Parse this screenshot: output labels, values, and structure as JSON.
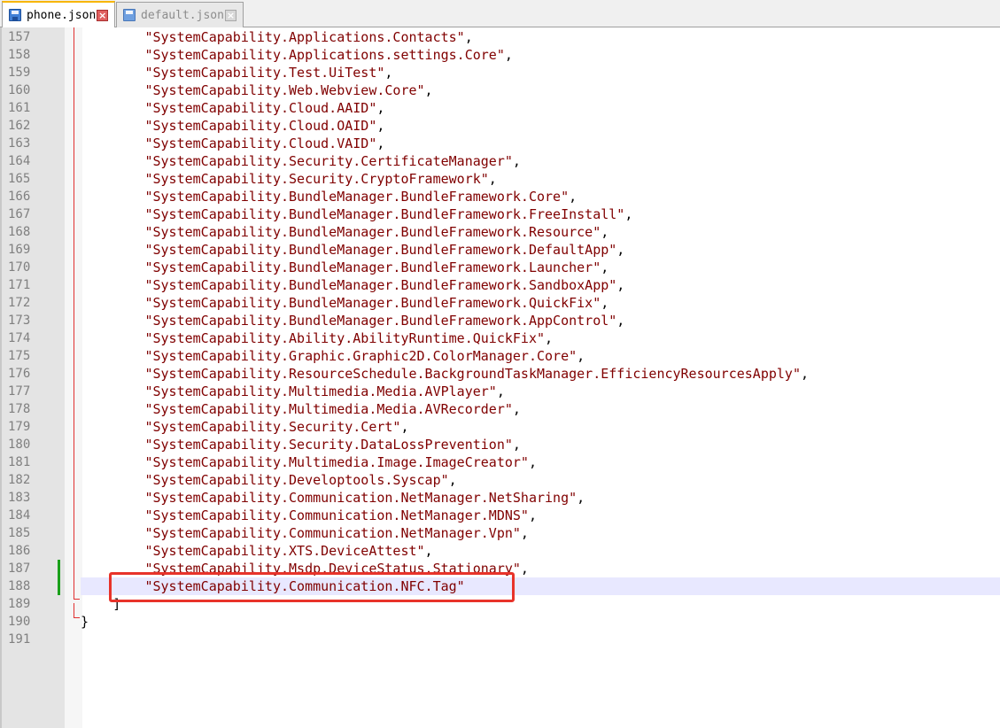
{
  "tabs": [
    {
      "label": "phone.json",
      "active": true
    },
    {
      "label": "default.json",
      "active": false
    }
  ],
  "editor": {
    "lines": [
      {
        "num": "157",
        "text": "\"SystemCapability.Applications.Contacts\",",
        "indent": 4
      },
      {
        "num": "158",
        "text": "\"SystemCapability.Applications.settings.Core\",",
        "indent": 4
      },
      {
        "num": "159",
        "text": "\"SystemCapability.Test.UiTest\",",
        "indent": 4
      },
      {
        "num": "160",
        "text": "\"SystemCapability.Web.Webview.Core\",",
        "indent": 4
      },
      {
        "num": "161",
        "text": "\"SystemCapability.Cloud.AAID\",",
        "indent": 4
      },
      {
        "num": "162",
        "text": "\"SystemCapability.Cloud.OAID\",",
        "indent": 4
      },
      {
        "num": "163",
        "text": "\"SystemCapability.Cloud.VAID\",",
        "indent": 4
      },
      {
        "num": "164",
        "text": "\"SystemCapability.Security.CertificateManager\",",
        "indent": 4
      },
      {
        "num": "165",
        "text": "\"SystemCapability.Security.CryptoFramework\",",
        "indent": 4
      },
      {
        "num": "166",
        "text": "\"SystemCapability.BundleManager.BundleFramework.Core\",",
        "indent": 4
      },
      {
        "num": "167",
        "text": "\"SystemCapability.BundleManager.BundleFramework.FreeInstall\",",
        "indent": 4
      },
      {
        "num": "168",
        "text": "\"SystemCapability.BundleManager.BundleFramework.Resource\",",
        "indent": 4
      },
      {
        "num": "169",
        "text": "\"SystemCapability.BundleManager.BundleFramework.DefaultApp\",",
        "indent": 4
      },
      {
        "num": "170",
        "text": "\"SystemCapability.BundleManager.BundleFramework.Launcher\",",
        "indent": 4
      },
      {
        "num": "171",
        "text": "\"SystemCapability.BundleManager.BundleFramework.SandboxApp\",",
        "indent": 4
      },
      {
        "num": "172",
        "text": "\"SystemCapability.BundleManager.BundleFramework.QuickFix\",",
        "indent": 4
      },
      {
        "num": "173",
        "text": "\"SystemCapability.BundleManager.BundleFramework.AppControl\",",
        "indent": 4
      },
      {
        "num": "174",
        "text": "\"SystemCapability.Ability.AbilityRuntime.QuickFix\",",
        "indent": 4
      },
      {
        "num": "175",
        "text": "\"SystemCapability.Graphic.Graphic2D.ColorManager.Core\",",
        "indent": 4
      },
      {
        "num": "176",
        "text": "\"SystemCapability.ResourceSchedule.BackgroundTaskManager.EfficiencyResourcesApply\",",
        "indent": 4
      },
      {
        "num": "177",
        "text": "\"SystemCapability.Multimedia.Media.AVPlayer\",",
        "indent": 4
      },
      {
        "num": "178",
        "text": "\"SystemCapability.Multimedia.Media.AVRecorder\",",
        "indent": 4
      },
      {
        "num": "179",
        "text": "\"SystemCapability.Security.Cert\",",
        "indent": 4
      },
      {
        "num": "180",
        "text": "\"SystemCapability.Security.DataLossPrevention\",",
        "indent": 4
      },
      {
        "num": "181",
        "text": "\"SystemCapability.Multimedia.Image.ImageCreator\",",
        "indent": 4
      },
      {
        "num": "182",
        "text": "\"SystemCapability.Developtools.Syscap\",",
        "indent": 4
      },
      {
        "num": "183",
        "text": "\"SystemCapability.Communication.NetManager.NetSharing\",",
        "indent": 4
      },
      {
        "num": "184",
        "text": "\"SystemCapability.Communication.NetManager.MDNS\",",
        "indent": 4
      },
      {
        "num": "185",
        "text": "\"SystemCapability.Communication.NetManager.Vpn\",",
        "indent": 4
      },
      {
        "num": "186",
        "text": "\"SystemCapability.XTS.DeviceAttest\",",
        "indent": 4
      },
      {
        "num": "187",
        "text": "\"SystemCapability.Msdp.DeviceStatus.Stationary\",",
        "indent": 4
      },
      {
        "num": "188",
        "text": "\"SystemCapability.Communication.NFC.Tag\"",
        "indent": 4
      },
      {
        "num": "189",
        "text": "]",
        "indent": 2
      },
      {
        "num": "190",
        "text": "}",
        "indent": 0
      },
      {
        "num": "191",
        "text": "",
        "indent": 0
      }
    ]
  },
  "colors": {
    "string": "#800000",
    "highlight_box": "#e8332a",
    "current_line": "#e8e8ff",
    "change_marker": "#1aa01a"
  }
}
